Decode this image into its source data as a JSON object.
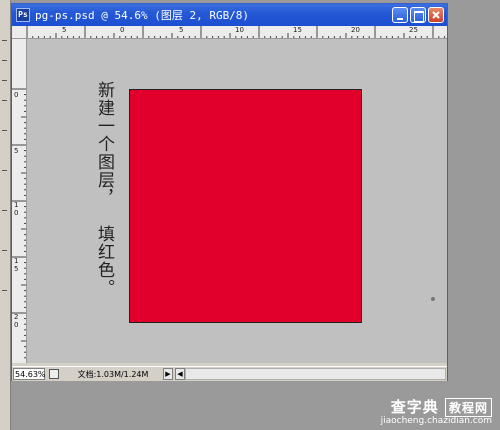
{
  "window": {
    "title": "pg-ps.psd @ 54.6% (图层 2, RGB/8)",
    "app_icon": "photoshop-document-icon",
    "buttons": [
      "minimize-icon",
      "maximize-icon",
      "close-icon"
    ]
  },
  "rulers": {
    "horizontal_labels": [
      "5",
      "0",
      "5",
      "10",
      "15",
      "20",
      "25"
    ],
    "vertical_labels": [
      "0",
      "5",
      "1\n0",
      "1\n5",
      "2\n0"
    ]
  },
  "canvas": {
    "layer_color": "#e0002b",
    "annotation_line1": "新建一个图层，",
    "annotation_line2": "填红色。"
  },
  "statusbar": {
    "zoom": "54.63%",
    "doc_info": "文档:1.03M/1.24M",
    "arrow_right": "▶",
    "arrow_left": "◀"
  },
  "watermark": {
    "line1_a": "查字典",
    "line1_b": "教程网",
    "line2": "jiaocheng.chazidian.com"
  }
}
